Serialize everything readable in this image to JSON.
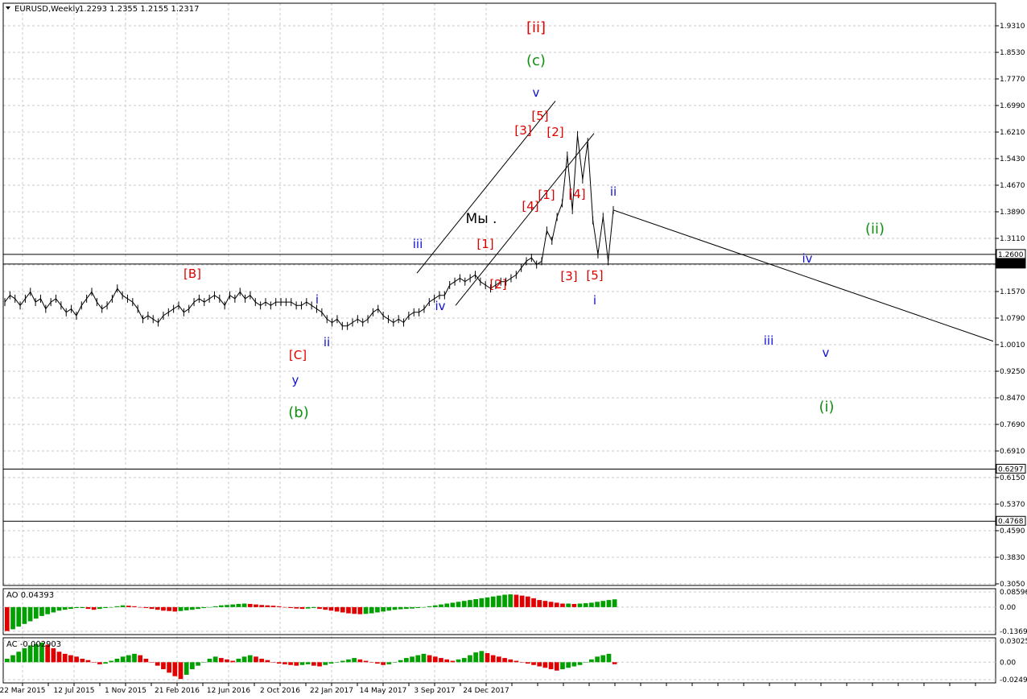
{
  "header": {
    "symbol": "EURUSD,Weekly",
    "ohlc": "1.2293 1.2355 1.2155 1.2317"
  },
  "colors": {
    "background": "#ffffff",
    "grid": "#c8c8c8",
    "candle": "#000000",
    "wave_red": "#e00000",
    "wave_blue": "#1010d0",
    "wave_green": "#109010",
    "ind_up": "#00a000",
    "ind_down": "#e00000"
  },
  "chart_data": [
    {
      "type": "line",
      "name": "main-price",
      "ylim": [
        0.28,
        1.99
      ],
      "y_ticks": [
        "1.9310",
        "1.8530",
        "1.7770",
        "1.6990",
        "1.6210",
        "1.5430",
        "1.4670",
        "1.3890",
        "1.3110",
        "1.2330",
        "1.1570",
        "1.0790",
        "1.0010",
        "0.9250",
        "0.8470",
        "0.7690",
        "0.6910",
        "0.6150",
        "0.5370",
        "0.4590",
        "0.3830",
        "0.3050"
      ],
      "x_tick_labels": [
        "22 Mar 2015",
        "12 Jul 2015",
        "1 Nov 2015",
        "21 Feb 2016",
        "12 Jun 2016",
        "2 Oct 2016",
        "22 Jan 2017",
        "14 May 2017",
        "3 Sep 2017",
        "24 Dec 2017"
      ],
      "horizontal_levels": [
        {
          "value": 1.26,
          "label": "1.2600"
        },
        {
          "value": 1.2317,
          "label": "1.2317",
          "highlight": true
        },
        {
          "value": 0.6297,
          "label": "0.6297"
        },
        {
          "value": 0.4768,
          "label": "0.4768"
        }
      ],
      "price_series": [
        1.12,
        1.14,
        1.13,
        1.11,
        1.13,
        1.15,
        1.12,
        1.13,
        1.1,
        1.12,
        1.13,
        1.11,
        1.09,
        1.1,
        1.08,
        1.11,
        1.13,
        1.15,
        1.12,
        1.1,
        1.11,
        1.13,
        1.16,
        1.14,
        1.13,
        1.12,
        1.1,
        1.07,
        1.08,
        1.07,
        1.06,
        1.08,
        1.09,
        1.1,
        1.11,
        1.09,
        1.1,
        1.12,
        1.13,
        1.12,
        1.13,
        1.14,
        1.13,
        1.11,
        1.14,
        1.13,
        1.15,
        1.13,
        1.14,
        1.12,
        1.11,
        1.12,
        1.11,
        1.12,
        1.12,
        1.12,
        1.12,
        1.11,
        1.11,
        1.12,
        1.11,
        1.1,
        1.09,
        1.07,
        1.06,
        1.07,
        1.05,
        1.05,
        1.06,
        1.07,
        1.06,
        1.07,
        1.09,
        1.1,
        1.08,
        1.07,
        1.06,
        1.07,
        1.06,
        1.08,
        1.09,
        1.09,
        1.1,
        1.12,
        1.13,
        1.14,
        1.14,
        1.17,
        1.18,
        1.19,
        1.18,
        1.19,
        1.2,
        1.18,
        1.17,
        1.16,
        1.17,
        1.18,
        1.18,
        1.19,
        1.2,
        1.22,
        1.24,
        1.25,
        1.23,
        1.24,
        1.33,
        1.3,
        1.37,
        1.41,
        1.55,
        1.39,
        1.61,
        1.48,
        1.59,
        1.36,
        1.26,
        1.37,
        1.24,
        1.39
      ],
      "projection_line": [
        [
          0,
          1.39
        ],
        [
          1,
          1.005
        ]
      ],
      "channel_lines": "two parallel trend lines across the 2017-2018 advance",
      "wave_labels": [
        {
          "text": "[ii]",
          "color": "red"
        },
        {
          "text": "(c)",
          "color": "green"
        },
        {
          "text": "v",
          "color": "blue"
        },
        {
          "text": "[5]",
          "color": "red"
        },
        {
          "text": "[3]",
          "color": "red"
        },
        {
          "text": "[2]",
          "color": "red"
        },
        {
          "text": "[1]",
          "color": "red"
        },
        {
          "text": "[4]",
          "color": "red"
        },
        {
          "text": "[4]",
          "color": "red"
        },
        {
          "text": "ii",
          "color": "blue"
        },
        {
          "text": "Мы .",
          "color": "black"
        },
        {
          "text": "iii",
          "color": "blue"
        },
        {
          "text": "[1]",
          "color": "red"
        },
        {
          "text": "[2]",
          "color": "red"
        },
        {
          "text": "[3]",
          "color": "red"
        },
        {
          "text": "[5]",
          "color": "red"
        },
        {
          "text": "i",
          "color": "blue"
        },
        {
          "text": "iv",
          "color": "blue"
        },
        {
          "text": "[B]",
          "color": "red"
        },
        {
          "text": "i",
          "color": "blue"
        },
        {
          "text": "ii",
          "color": "blue"
        },
        {
          "text": "[C]",
          "color": "red"
        },
        {
          "text": "y",
          "color": "blue"
        },
        {
          "text": "(b)",
          "color": "green"
        },
        {
          "text": "(ii)",
          "color": "green"
        },
        {
          "text": "iv",
          "color": "blue"
        },
        {
          "text": "iii",
          "color": "blue"
        },
        {
          "text": "v",
          "color": "blue"
        },
        {
          "text": "(i)",
          "color": "green"
        }
      ]
    },
    {
      "type": "bar",
      "name": "AO",
      "title": "AO 0.04393",
      "y_ticks": [
        "0.08596",
        "0.00",
        "-0.13691"
      ],
      "ylim": [
        -0.1369,
        0.086
      ],
      "values": [
        -0.135,
        -0.125,
        -0.11,
        -0.095,
        -0.08,
        -0.065,
        -0.05,
        -0.04,
        -0.03,
        -0.02,
        -0.015,
        -0.01,
        -0.005,
        -0.005,
        -0.01,
        -0.015,
        -0.01,
        -0.005,
        0.0,
        0.005,
        0.01,
        0.008,
        0.005,
        0.0,
        -0.005,
        -0.01,
        -0.015,
        -0.02,
        -0.022,
        -0.025,
        -0.022,
        -0.018,
        -0.015,
        -0.01,
        -0.005,
        0.0,
        0.005,
        0.01,
        0.012,
        0.015,
        0.018,
        0.02,
        0.018,
        0.015,
        0.012,
        0.01,
        0.008,
        0.005,
        0.0,
        -0.005,
        -0.008,
        -0.01,
        -0.008,
        -0.005,
        -0.01,
        -0.015,
        -0.02,
        -0.025,
        -0.03,
        -0.035,
        -0.038,
        -0.04,
        -0.038,
        -0.035,
        -0.03,
        -0.025,
        -0.02,
        -0.015,
        -0.012,
        -0.01,
        -0.008,
        -0.005,
        0.0,
        0.005,
        0.01,
        0.015,
        0.02,
        0.025,
        0.03,
        0.035,
        0.04,
        0.045,
        0.05,
        0.055,
        0.06,
        0.065,
        0.07,
        0.072,
        0.07,
        0.065,
        0.06,
        0.05,
        0.04,
        0.035,
        0.03,
        0.025,
        0.02,
        0.02,
        0.018,
        0.02,
        0.022,
        0.025,
        0.03,
        0.035,
        0.04,
        0.044
      ],
      "value_label": "0.04393"
    },
    {
      "type": "bar",
      "name": "AC",
      "title": "AC -0.002903",
      "y_ticks": [
        "0.030257",
        "0.00",
        "-0.02499"
      ],
      "ylim": [
        -0.025,
        0.0303
      ],
      "values": [
        0.005,
        0.01,
        0.015,
        0.02,
        0.024,
        0.026,
        0.028,
        0.025,
        0.02,
        0.015,
        0.012,
        0.01,
        0.008,
        0.005,
        0.003,
        0.0,
        -0.003,
        -0.002,
        0.002,
        0.005,
        0.008,
        0.01,
        0.012,
        0.01,
        0.005,
        0.0,
        -0.005,
        -0.01,
        -0.015,
        -0.02,
        -0.024,
        -0.018,
        -0.01,
        -0.005,
        0.0,
        0.005,
        0.008,
        0.006,
        0.004,
        0.002,
        0.005,
        0.008,
        0.01,
        0.008,
        0.005,
        0.003,
        0.0,
        -0.002,
        -0.003,
        -0.004,
        -0.005,
        -0.004,
        -0.003,
        -0.005,
        -0.006,
        -0.004,
        -0.002,
        0.0,
        0.002,
        0.004,
        0.006,
        0.004,
        0.002,
        0.0,
        -0.002,
        -0.004,
        -0.003,
        0.0,
        0.003,
        0.006,
        0.008,
        0.01,
        0.012,
        0.01,
        0.008,
        0.006,
        0.004,
        0.002,
        0.004,
        0.006,
        0.01,
        0.014,
        0.016,
        0.013,
        0.01,
        0.008,
        0.006,
        0.004,
        0.002,
        0.0,
        -0.002,
        -0.004,
        -0.006,
        -0.008,
        -0.01,
        -0.012,
        -0.01,
        -0.008,
        -0.006,
        -0.004,
        0.0,
        0.004,
        0.008,
        0.01,
        0.012,
        -0.0029
      ],
      "value_label": "-0.002903"
    }
  ]
}
